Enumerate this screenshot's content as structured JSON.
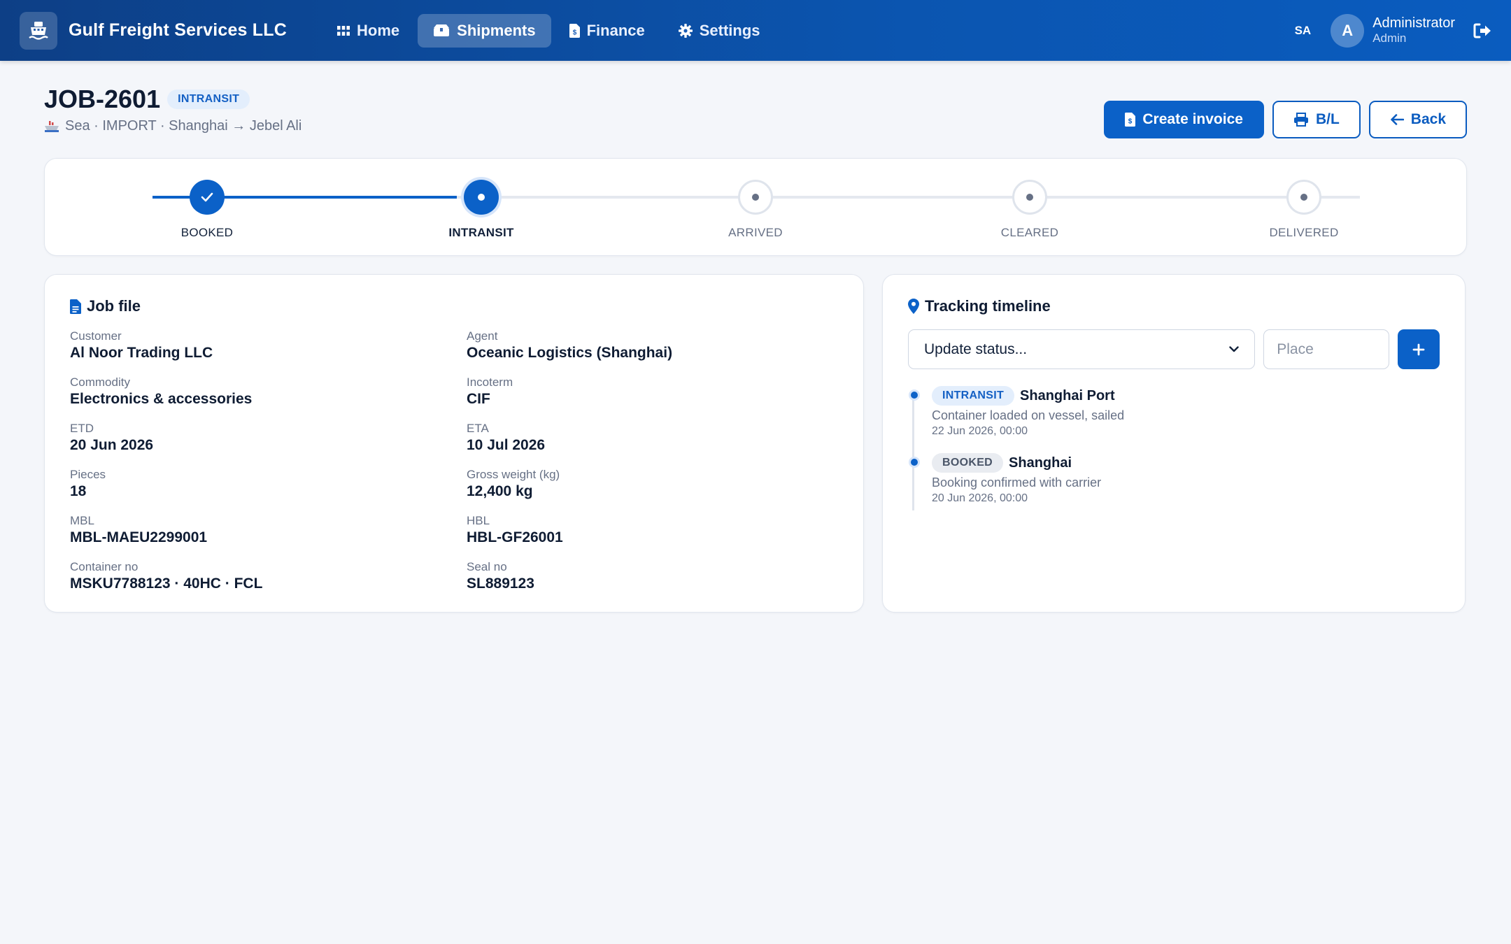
{
  "app": {
    "brand": "Gulf Freight Services LLC",
    "nav": [
      {
        "label": "Home",
        "icon": "grid-icon"
      },
      {
        "label": "Shipments",
        "icon": "boxes-icon"
      },
      {
        "label": "Finance",
        "icon": "invoice-icon"
      },
      {
        "label": "Settings",
        "icon": "gear-icon"
      }
    ],
    "active_nav": "Shipments",
    "lang": "SA",
    "user": {
      "initial": "A",
      "name": "Administrator",
      "role": "Admin"
    }
  },
  "job": {
    "id": "JOB-2601",
    "status": "INTRANSIT",
    "subline": "Sea · IMPORT · Shanghai → Jebel Ali",
    "actions": {
      "invoice": "Create invoice",
      "bl": "B/L",
      "back": "Back"
    }
  },
  "stepper": {
    "steps": [
      "BOOKED",
      "INTRANSIT",
      "ARRIVED",
      "CLEARED",
      "DELIVERED"
    ],
    "current_index": 1
  },
  "job_file": {
    "title": "Job file",
    "fields": [
      {
        "label": "Customer",
        "value": "Al Noor Trading LLC"
      },
      {
        "label": "Agent",
        "value": "Oceanic Logistics (Shanghai)"
      },
      {
        "label": "Commodity",
        "value": "Electronics & accessories"
      },
      {
        "label": "Incoterm",
        "value": "CIF"
      },
      {
        "label": "ETD",
        "value": "20 Jun 2026"
      },
      {
        "label": "ETA",
        "value": "10 Jul 2026"
      },
      {
        "label": "Pieces",
        "value": "18"
      },
      {
        "label": "Gross weight (kg)",
        "value": "12,400 kg"
      },
      {
        "label": "MBL",
        "value": "MBL-MAEU2299001"
      },
      {
        "label": "HBL",
        "value": "HBL-GF26001"
      },
      {
        "label": "Container no",
        "value": "MSKU7788123 · 40HC · FCL"
      },
      {
        "label": "Seal no",
        "value": "SL889123"
      }
    ]
  },
  "tracking": {
    "title": "Tracking timeline",
    "select_value": "Update status...",
    "place_placeholder": "Place",
    "events": [
      {
        "status": "INTRANSIT",
        "place": "Shanghai Port",
        "desc": "Container loaded on vessel, sailed",
        "time": "22 Jun 2026, 00:00"
      },
      {
        "status": "BOOKED",
        "place": "Shanghai",
        "desc": "Booking confirmed with carrier",
        "time": "20 Jun 2026, 00:00"
      }
    ]
  }
}
